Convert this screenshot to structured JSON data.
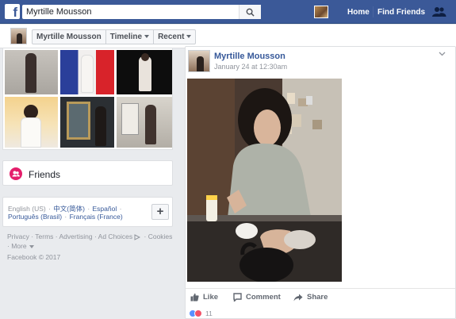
{
  "topbar": {
    "logo": "f",
    "search_value": "Myrtille Mousson",
    "links": [
      "Home",
      "Find Friends"
    ]
  },
  "profile_nav": {
    "name": "Myrtille Mousson",
    "timeline": "Timeline",
    "recent": "Recent"
  },
  "sidebar": {
    "friends_label": "Friends",
    "languages": {
      "current": "English (US)",
      "items": [
        "中文(简体)",
        "Español",
        "Português (Brasil)",
        "Français (France)"
      ],
      "add_label": "+"
    },
    "footer_links": [
      "Privacy",
      "Terms",
      "Advertising",
      "Ad Choices",
      "Cookies",
      "More"
    ],
    "copyright": "Facebook © 2017"
  },
  "post": {
    "author": "Myrtille Mousson",
    "timestamp": "January 24 at 12:30am",
    "actions": {
      "like": "Like",
      "comment": "Comment",
      "share": "Share"
    },
    "reaction_count": "11"
  },
  "colors": {
    "brand": "#3b5998",
    "link": "#365899",
    "friends_badge": "#e41e6b",
    "background": "#e9ebee"
  },
  "icons": [
    "search-icon",
    "friends-requests-icon",
    "like-icon",
    "comment-icon",
    "share-icon",
    "chevron-down-icon",
    "friends-icon"
  ]
}
